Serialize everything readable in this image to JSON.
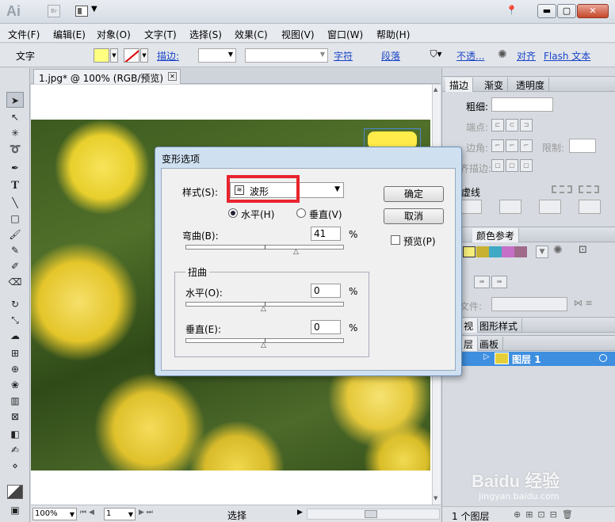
{
  "app": {
    "logo": "Ai",
    "bridge_label": "Br"
  },
  "window_controls": {
    "minimize": "▬",
    "maximize": "▢",
    "close": "✕"
  },
  "menu": [
    "文件(F)",
    "编辑(E)",
    "对象(O)",
    "文字(T)",
    "选择(S)",
    "效果(C)",
    "视图(V)",
    "窗口(W)",
    "帮助(H)"
  ],
  "control_bar": {
    "selection_type": "文字",
    "fill_color": "#ffff80",
    "stroke_label": "描边:",
    "character_label": "字符",
    "paragraph_label": "段落",
    "opacity_label": "不透...",
    "align_label": "对齐",
    "flash_label": "Flash 文本"
  },
  "document": {
    "tab_title": "1.jpg* @ 100% (RGB/预览)",
    "zoom": "100%",
    "page": "1",
    "status_tool": "选择"
  },
  "panels": {
    "stroke_tabs": [
      "描边",
      "渐变",
      "透明度"
    ],
    "weight_label": "粗细:",
    "cap_label": "端点:",
    "corner_label": "边角:",
    "limit_label": "限制:",
    "align_stroke_label": "齐描边:",
    "dashed_label": "虚线",
    "color_guide_tab": "颜色参考",
    "swatch_colors": [
      "#f6ee7a",
      "#c8b030",
      "#3fa8c4",
      "#c66fc8",
      "#a06a8a"
    ],
    "file_label": "文件:",
    "appearance_tabs": [
      "视",
      "图形样式"
    ],
    "layers_tabs": [
      "层",
      "画板"
    ],
    "layer_name": "图层 1",
    "layers_count": "1 个图层"
  },
  "dialog": {
    "title": "变形选项",
    "style_label": "样式(S):",
    "style_value": "波形",
    "horizontal_label": "水平(H)",
    "vertical_label": "垂直(V)",
    "orientation": "horizontal",
    "bend_label": "弯曲(B):",
    "bend_value": "41",
    "percent": "%",
    "distortion_label": "扭曲",
    "distort_h_label": "水平(O):",
    "distort_h_value": "0",
    "distort_v_label": "垂直(E):",
    "distort_v_value": "0",
    "ok_label": "确定",
    "cancel_label": "取消",
    "preview_label": "预览(P)",
    "preview_checked": false,
    "bend_slider_percent": 41,
    "distort_h_slider_percent": 0,
    "distort_v_slider_percent": 0
  },
  "watermark": {
    "text": "Baidu 经验",
    "url": "jingyan.baidu.com"
  }
}
